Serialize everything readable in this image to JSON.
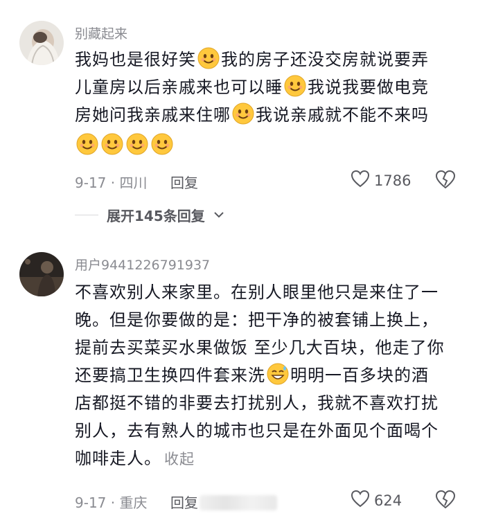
{
  "comments": [
    {
      "username": "别藏起来",
      "lines": [
        [
          "我妈也是很好笑",
          "emoji",
          "我的房子还没交房就说要弄"
        ],
        [
          "儿童房以后亲戚来也可以睡",
          "emoji",
          "我说我要做电竞"
        ],
        [
          "房她问我亲戚来住哪",
          "emoji",
          "我说亲戚就不能不来吗"
        ],
        [
          "emoji",
          "emoji",
          "emoji",
          "emoji"
        ]
      ],
      "date_location": "9-17 · 四川",
      "reply_label": "回复",
      "like_count": "1786"
    },
    {
      "username": "用户9441226791937",
      "lines": [
        "不喜欢别人来家里。在别人眼里他只是来住了一",
        "晚。但是你要做的是：把干净的被套铺上换上，",
        "提前去买菜买水果做饭 至少几大百块，他走了你",
        "还要搞卫生换四件套来洗 [sweat] 明明一百多块的酒",
        "店都挺不错的非要去打扰别人，我就不喜欢打扰",
        "别人，去有熟人的城市也只是在外面见个面喝个",
        "咖啡走人。"
      ],
      "line4_before": "还要搞卫生换四件套来洗",
      "line4_after": "明明一百多块的酒",
      "collapse_label": "收起",
      "date_location": "9-17 · 重庆",
      "reply_label": "回复",
      "like_count": "624"
    }
  ],
  "expand_replies_label": "展开145条回复",
  "icons": {
    "emoji": "smile-emoji-icon",
    "sweat": "sweat-smile-emoji-icon",
    "like": "heart-outline-icon",
    "dislike": "broken-heart-icon",
    "expand": "chevron-down-icon"
  },
  "colors": {
    "text": "#161823",
    "secondary": "#8a8b91",
    "emoji_face": "#ffc83d"
  }
}
